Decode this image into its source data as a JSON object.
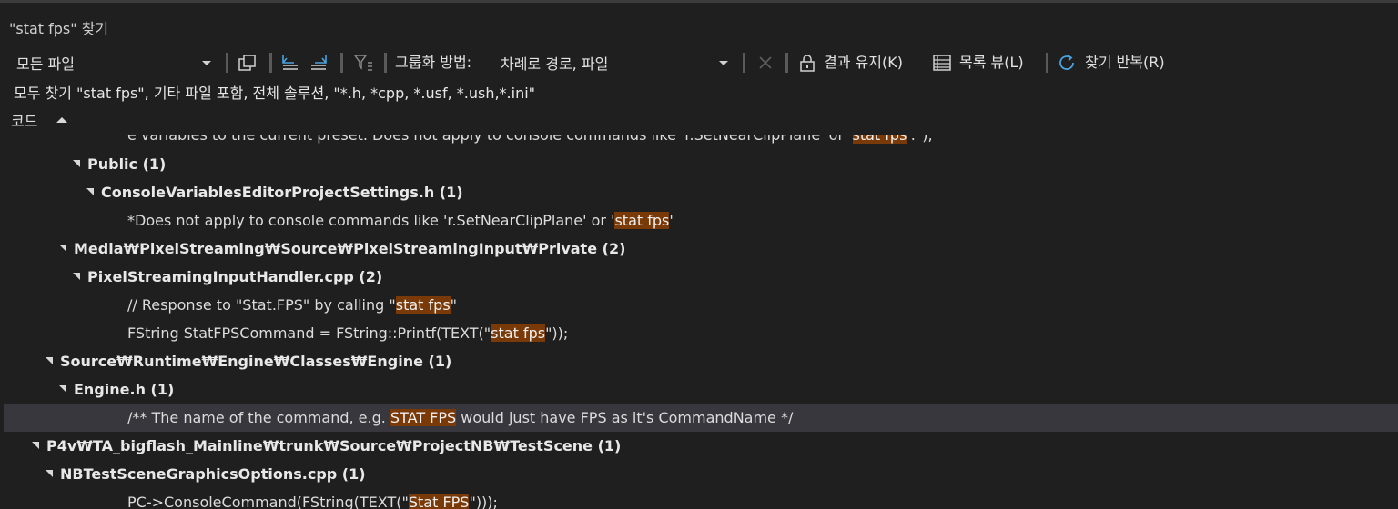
{
  "title": "\"stat fps\" 찾기",
  "toolbar": {
    "scope_value": "모든 파일",
    "group_label": "그룹화 방법:",
    "group_value": "차례로 경로, 파일",
    "keep_results_label": "결과 유지(K)",
    "list_view_label": "목록 뷰(L)",
    "repeat_find_label": "찾기 반복(R)"
  },
  "description": "모두 찾기 \"stat fps\", 기타 파일 포함, 전체 솔루션, \"*.h, *cpp, *.usf, *.ush,*.ini\"",
  "column_header": "코드",
  "results": [
    {
      "kind": "code",
      "pre": "e variables to the current preset. Does not apply to console commands like 'r.SetNearClipPlane' or '",
      "match": "stat fps",
      "post": "'.\");"
    },
    {
      "kind": "group",
      "text": "Public  (1)"
    },
    {
      "kind": "group",
      "text": "ConsoleVariablesEditorProjectSettings.h  (1)"
    },
    {
      "kind": "code",
      "pre": "*Does not apply to console commands like 'r.SetNearClipPlane' or '",
      "match": "stat fps",
      "post": "'"
    },
    {
      "kind": "group",
      "text": "Media₩PixelStreaming₩Source₩PixelStreamingInput₩Private  (2)"
    },
    {
      "kind": "group",
      "text": "PixelStreamingInputHandler.cpp  (2)"
    },
    {
      "kind": "code",
      "pre": "// Response to \"Stat.FPS\" by calling \"",
      "match": "stat fps",
      "post": "\""
    },
    {
      "kind": "code",
      "pre": "FString StatFPSCommand = FString::Printf(TEXT(\"",
      "match": "stat fps",
      "post": "\"));"
    },
    {
      "kind": "group",
      "text": "Source₩Runtime₩Engine₩Classes₩Engine  (1)"
    },
    {
      "kind": "group",
      "text": "Engine.h  (1)"
    },
    {
      "kind": "code",
      "pre": "/** The name of the command, e.g. ",
      "match": "STAT FPS",
      "post": " would just have FPS as it's CommandName */"
    },
    {
      "kind": "group",
      "text": "P4v₩TA_bigflash_Mainline₩trunk₩Source₩ProjectNB₩TestScene  (1)"
    },
    {
      "kind": "group",
      "text": "NBTestSceneGraphicsOptions.cpp  (1)"
    },
    {
      "kind": "code",
      "pre": "PC->ConsoleCommand(FString(TEXT(\"",
      "match": "Stat FPS",
      "post": "\")));"
    }
  ],
  "colors": {
    "background": "#1f1f1f",
    "highlight": "#7a3a08",
    "selected_row": "#37373d",
    "accent_icon": "#4aa3df"
  }
}
